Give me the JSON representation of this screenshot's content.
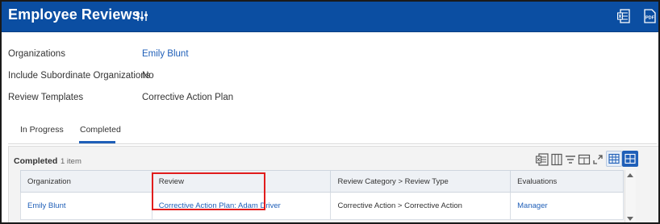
{
  "header": {
    "title": "Employee Reviews",
    "filter_icon": "sliders-icon",
    "excel_icon": "export-excel-icon",
    "pdf_icon": "export-pdf-icon",
    "pdf_text": "PDF",
    "color": "#0b4ea2"
  },
  "fields": [
    {
      "label": "Organizations",
      "value": "Emily Blunt"
    },
    {
      "label": "Include Subordinate Organizations",
      "value": "No"
    },
    {
      "label": "Review Templates",
      "value": "Corrective Action Plan"
    }
  ],
  "tabs": [
    {
      "label": "In Progress",
      "selected": false
    },
    {
      "label": "Completed",
      "selected": true
    }
  ],
  "grid": {
    "title": "Completed",
    "count": "1 item",
    "toolbar_icons": [
      "export-excel-icon",
      "columns-icon",
      "filter-icon",
      "split-view-icon",
      "fullscreen-icon",
      "table-view-icon",
      "grid-view-icon"
    ],
    "columns": [
      "Organization",
      "Review",
      "Review Category > Review Type",
      "Evaluations"
    ],
    "rows": [
      [
        "Emily Blunt",
        "Corrective Action Plan: Adam Driver",
        "Corrective Action > Corrective Action",
        "Manager"
      ]
    ]
  },
  "colors": {
    "link": "#1f5fb8",
    "highlight": "#e11d1d"
  }
}
